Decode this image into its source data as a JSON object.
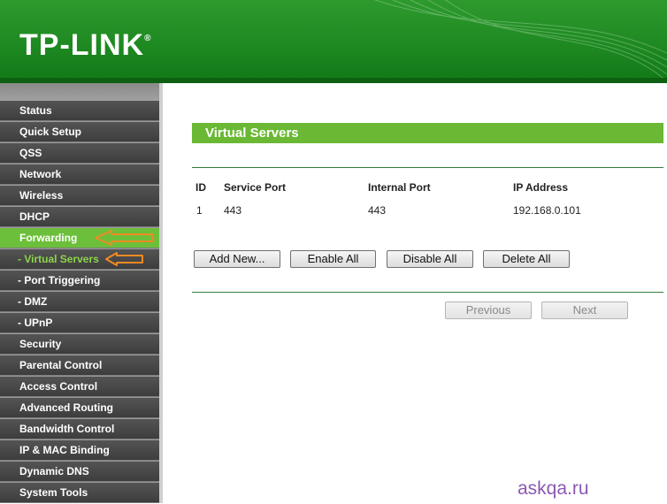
{
  "header": {
    "logo_text": "TP-LINK",
    "logo_mark": "®"
  },
  "sidebar": {
    "items": [
      {
        "label": "Status"
      },
      {
        "label": "Quick Setup"
      },
      {
        "label": "QSS"
      },
      {
        "label": "Network"
      },
      {
        "label": "Wireless"
      },
      {
        "label": "DHCP"
      },
      {
        "label": "Forwarding",
        "state": "active"
      },
      {
        "label": "- Virtual Servers",
        "state": "selected"
      },
      {
        "label": "- Port Triggering"
      },
      {
        "label": "- DMZ"
      },
      {
        "label": "- UPnP"
      },
      {
        "label": "Security"
      },
      {
        "label": "Parental Control"
      },
      {
        "label": "Access Control"
      },
      {
        "label": "Advanced Routing"
      },
      {
        "label": "Bandwidth Control"
      },
      {
        "label": "IP & MAC Binding"
      },
      {
        "label": "Dynamic DNS"
      },
      {
        "label": "System Tools"
      }
    ]
  },
  "main": {
    "title": "Virtual Servers",
    "table": {
      "headers": [
        "ID",
        "Service Port",
        "Internal Port",
        "IP Address"
      ],
      "rows": [
        [
          "1",
          "443",
          "443",
          "192.168.0.101"
        ]
      ]
    },
    "buttons": {
      "add_new": "Add New...",
      "enable_all": "Enable All",
      "disable_all": "Disable All",
      "delete_all": "Delete All"
    },
    "pager": {
      "previous": "Previous",
      "next": "Next"
    }
  },
  "watermark": "askqa.ru",
  "colors": {
    "brand_green": "#1f8a22",
    "accent_green": "#6ab834",
    "annotation_arrow": "#f08a24",
    "watermark": "#8a59b3"
  }
}
